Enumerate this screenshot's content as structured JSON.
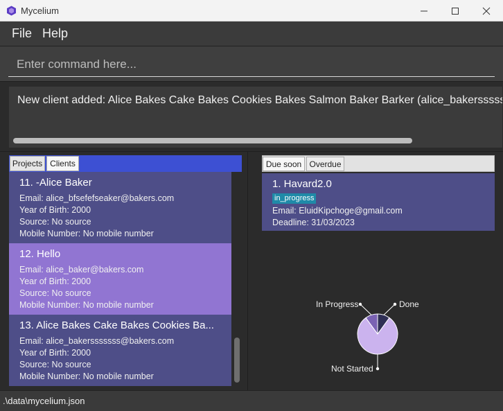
{
  "window": {
    "title": "Mycelium"
  },
  "menu": {
    "file": "File",
    "help": "Help"
  },
  "command": {
    "placeholder": "Enter command here...",
    "value": ""
  },
  "result": {
    "text": "New client added: Alice Bakes Cake Bakes Cookies Bakes Salmon Baker Barker (alice_bakerssssss"
  },
  "left_tabs": {
    "projects": "Projects",
    "clients": "Clients",
    "active": "Clients"
  },
  "clients": [
    {
      "title": "11.  -Alice Baker",
      "email": "Email: alice_bfsefefseaker@bakers.com",
      "yob": "Year of Birth: 2000",
      "source": "Source: No source",
      "mobile": "Mobile Number: No mobile number",
      "selected": false
    },
    {
      "title": "12.  Hello",
      "email": "Email: alice_baker@bakers.com",
      "yob": "Year of Birth: 2000",
      "source": "Source: No source",
      "mobile": "Mobile Number: No mobile number",
      "selected": true
    },
    {
      "title": "13.  Alice Bakes Cake Bakes Cookies Ba...",
      "email": "Email: alice_bakersssssss@bakers.com",
      "yob": "Year of Birth: 2000",
      "source": "Source: No source",
      "mobile": "Mobile Number: No mobile number",
      "selected": false
    }
  ],
  "right_tabs": {
    "due_soon": "Due soon",
    "overdue": "Overdue",
    "active": "Due soon"
  },
  "project": {
    "title": "1.  Havard2.0",
    "status": "in_progress",
    "email": "Email: EluidKipchoge@gmail.com",
    "deadline": "Deadline: 31/03/2023"
  },
  "chart_data": {
    "type": "pie",
    "categories": [
      "Not Started",
      "In Progress",
      "Done"
    ],
    "values": [
      0.8,
      0.1,
      0.1
    ],
    "colors": [
      "#cbb3ee",
      "#7a62b3",
      "#2f2f55"
    ]
  },
  "statusbar": {
    "path": ".\\data\\mycelium.json"
  }
}
